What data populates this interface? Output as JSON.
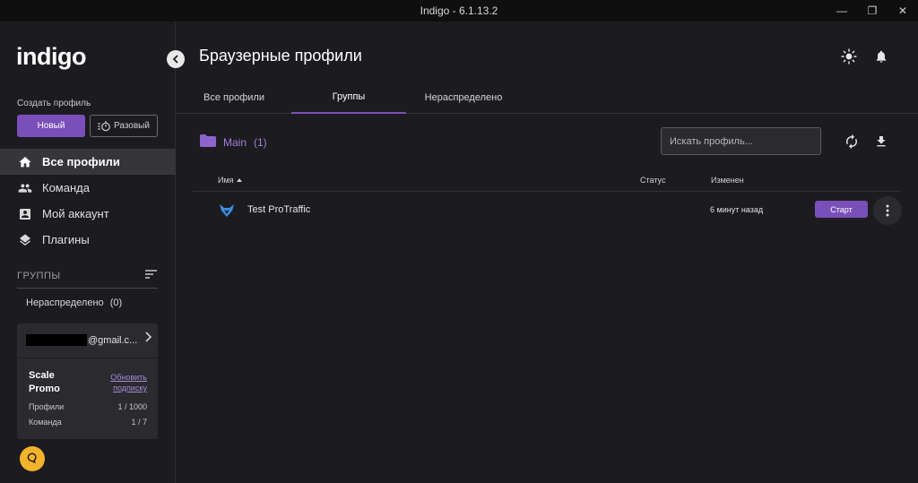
{
  "window": {
    "title": "Indigo - 6.1.13.2",
    "minimize_glyph": "—",
    "restore_glyph": "❐",
    "close_glyph": "✕"
  },
  "sidebar": {
    "logo": "indigo",
    "create_profile_label": "Создать профиль",
    "new_button": "Новый",
    "once_button": "Разовый",
    "nav": [
      {
        "label": "Все профили",
        "icon": "home-icon",
        "active": true
      },
      {
        "label": "Команда",
        "icon": "team-icon",
        "active": false
      },
      {
        "label": "Мой аккаунт",
        "icon": "account-icon",
        "active": false
      },
      {
        "label": "Плагины",
        "icon": "layers-icon",
        "active": false
      }
    ],
    "groups_label": "ГРУППЫ",
    "group_items": [
      {
        "label": "Нераспределено",
        "count": "(0)"
      }
    ],
    "account": {
      "email_suffix": "@gmail.c...",
      "plan_name": "Scale Promo",
      "upgrade_link": "Обновить подписку",
      "stats": [
        {
          "label": "Профили",
          "value": "1 / 1000"
        },
        {
          "label": "Команда",
          "value": "1 / 7"
        }
      ]
    }
  },
  "main": {
    "title": "Браузерные профили",
    "tabs": [
      {
        "label": "Все профили",
        "active": false
      },
      {
        "label": "Группы",
        "active": true
      },
      {
        "label": "Нераспределено",
        "active": false
      }
    ],
    "folder": {
      "name": "Main",
      "count": "(1)"
    },
    "search_placeholder": "Искать профиль...",
    "table": {
      "columns": {
        "name": "Имя",
        "status": "Статус",
        "modified": "Изменен"
      },
      "rows": [
        {
          "name": "Test ProTraffic",
          "status": "",
          "modified": "6 минут назад",
          "action": "Старт"
        }
      ]
    }
  },
  "colors": {
    "accent": "#7a4fb8",
    "background": "#1c1c20",
    "chat_button": "#f4b32c"
  }
}
